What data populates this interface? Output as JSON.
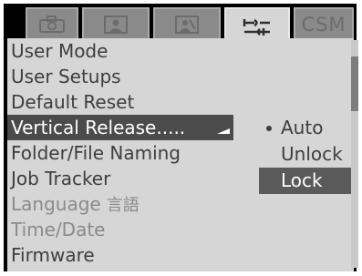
{
  "tabs": [
    {
      "icon": "camera-icon",
      "active": false
    },
    {
      "icon": "portrait-icon",
      "active": false
    },
    {
      "icon": "playback-icon",
      "active": false
    },
    {
      "icon": "wrench-icon",
      "active": true
    },
    {
      "label": "CSM",
      "active": false
    }
  ],
  "menu": {
    "items": [
      {
        "label": "User Mode",
        "state": "normal"
      },
      {
        "label": "User Setups",
        "state": "normal"
      },
      {
        "label": "Default Reset",
        "state": "normal"
      },
      {
        "label": "Vertical Release.....",
        "state": "selected"
      },
      {
        "label": "Folder/File Naming",
        "state": "normal"
      },
      {
        "label": "Job Tracker",
        "state": "normal"
      },
      {
        "label": "Language",
        "label_cjk": "言語",
        "state": "disabled"
      },
      {
        "label": "Time/Date",
        "state": "disabled"
      },
      {
        "label": "Firmware",
        "state": "normal"
      }
    ]
  },
  "submenu": {
    "items": [
      {
        "label": "Auto",
        "current": true,
        "highlighted": false
      },
      {
        "label": "Unlock",
        "current": false,
        "highlighted": false
      },
      {
        "label": "Lock",
        "current": false,
        "highlighted": true
      }
    ]
  },
  "colors": {
    "panel": "#d6d6d6",
    "tab_inactive": "#8a8a8a",
    "selected_row": "#4b4b4b",
    "text": "#3e3e3e",
    "text_disabled": "#8a8a8a"
  }
}
